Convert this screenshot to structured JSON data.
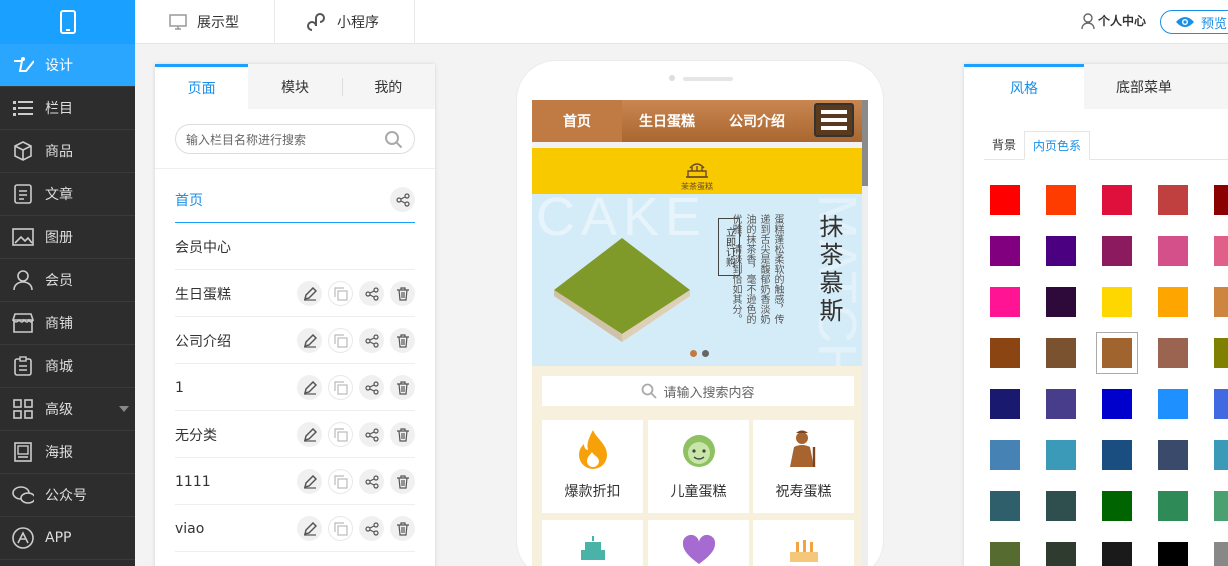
{
  "topbar": {
    "tab1": "展示型",
    "tab2": "小程序",
    "user": "个人中心",
    "preview": "预览"
  },
  "nav": {
    "items": [
      {
        "label": "设计",
        "icon": "design-icon"
      },
      {
        "label": "栏目",
        "icon": "list-icon"
      },
      {
        "label": "商品",
        "icon": "cube-icon"
      },
      {
        "label": "文章",
        "icon": "document-icon"
      },
      {
        "label": "图册",
        "icon": "image-icon"
      },
      {
        "label": "会员",
        "icon": "user-icon"
      },
      {
        "label": "商铺",
        "icon": "shop-icon"
      },
      {
        "label": "商城",
        "icon": "clipboard-icon"
      },
      {
        "label": "高级",
        "icon": "grid-icon"
      },
      {
        "label": "海报",
        "icon": "poster-icon"
      },
      {
        "label": "公众号",
        "icon": "wechat-icon"
      },
      {
        "label": "APP",
        "icon": "app-icon"
      }
    ]
  },
  "left_panel": {
    "tabs": [
      "页面",
      "模块",
      "我的"
    ],
    "search_placeholder": "输入栏目名称进行搜索",
    "rows": [
      "首页",
      "会员中心",
      "生日蛋糕",
      "公司介绍",
      "1",
      "无分类",
      "1111",
      "viao"
    ]
  },
  "phone": {
    "nav": [
      "首页",
      "生日蛋糕",
      "公司介绍"
    ],
    "logo_text": "茉茶蛋糕",
    "banner": {
      "title": "抹茶慕斯",
      "desc": "蛋糕蓬松柔软的触感，传递到舌尖是馥郁奶香淡奶油的抹茶香，毫不逊色的优雅，清淡到恰如其分。",
      "button": "立即订购",
      "bg_text": "CAKE",
      "bg_text2": "MATCHA"
    },
    "search_placeholder": "请输入搜索内容",
    "categories": [
      "爆款折扣",
      "儿童蛋糕",
      "祝寿蛋糕"
    ]
  },
  "right_panel": {
    "tabs": [
      "风格",
      "底部菜单"
    ],
    "subtabs": [
      "背景",
      "内页色系"
    ],
    "swatches": [
      [
        "#ff0000",
        "#ff3c00",
        "#e0103c",
        "#c04040",
        "#8b0000"
      ],
      [
        "#800080",
        "#4b0082",
        "#8b1a5e",
        "#d4508a",
        "#e0608a"
      ],
      [
        "#ff1493",
        "#2d0a3a",
        "#ffd700",
        "#ffa500",
        "#cd853f"
      ],
      [
        "#8b4513",
        "#7a5230",
        "#a0642e",
        "#9a6450",
        "#808000"
      ],
      [
        "#191970",
        "#483d8b",
        "#0000cd",
        "#1e90ff",
        "#4169e1"
      ],
      [
        "#4682b4",
        "#3a9ab8",
        "#1a4e80",
        "#3a4a6a",
        "#3a9ab8"
      ],
      [
        "#2f5f6a",
        "#2f4f4f",
        "#006400",
        "#2e8b57",
        "#4aa070"
      ],
      [
        "#556b2f",
        "#2e3b2e",
        "#1a1a1a",
        "#000000",
        "#888888"
      ]
    ],
    "selected": "#a0642e"
  }
}
